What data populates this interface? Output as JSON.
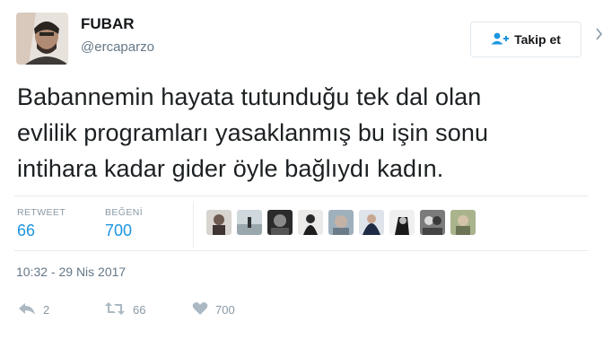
{
  "user": {
    "display_name": "FUBAR",
    "handle": "@ercaparzo",
    "follow_label": "Takip et"
  },
  "tweet": {
    "lines": [
      "Babannemin hayata tutunduğu tek dal olan",
      "evlilik programları yasaklanmış bu işin sonu",
      "intihara kadar gider öyle bağlıydı kadın."
    ],
    "timestamp": "10:32 - 29 Nis 2017"
  },
  "stats": {
    "retweet_label": "RETWEET",
    "retweet_count": "66",
    "like_label": "BEĞENİ",
    "like_count": "700"
  },
  "actions": {
    "reply_count": "2",
    "retweet_count": "66",
    "like_count": "700"
  },
  "colors": {
    "accent": "#1b95e0",
    "muted": "#8899a6",
    "text": "#1c2022"
  }
}
